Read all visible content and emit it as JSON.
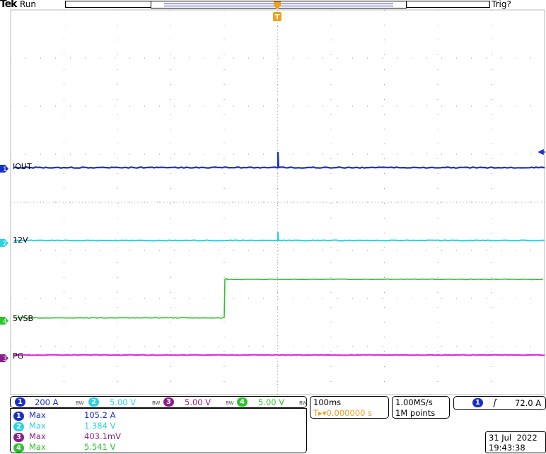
{
  "header": {
    "brand": "Tek",
    "run_state": "Run",
    "trigger_status": "Trig?"
  },
  "colors": {
    "ch1": "#1a2fc8",
    "ch2": "#2ad3e0",
    "ch3": "#8a1f8a",
    "ch4": "#2bc42b",
    "pg_trace": "#e020e0",
    "trigger": "#f0a020",
    "grid": "#9a9a9a"
  },
  "channels": [
    {
      "num": "1",
      "label": "IOUT",
      "scale": "200 A"
    },
    {
      "num": "2",
      "label": "12V",
      "scale": "5.00 V"
    },
    {
      "num": "3",
      "label": "PG",
      "scale": "5.00 V"
    },
    {
      "num": "4",
      "label": "5VSB",
      "scale": "5.00 V"
    }
  ],
  "measurements": [
    {
      "num": "1",
      "name": "Max",
      "value": "105.2 A"
    },
    {
      "num": "2",
      "name": "Max",
      "value": "1.384 V"
    },
    {
      "num": "3",
      "name": "Max",
      "value": "403.1mV"
    },
    {
      "num": "4",
      "name": "Max",
      "value": "5.541 V"
    }
  ],
  "timebase": {
    "scale": "100ms",
    "trigger_pos": "0.000000 s"
  },
  "acquisition": {
    "rate": "1.00MS/s",
    "points": "1M points"
  },
  "trigger": {
    "source": "1",
    "level": "72.0 A",
    "trigger_marker": "T"
  },
  "bandwidth_mark": "BW",
  "datetime": {
    "date": "31 Jul  2022",
    "time": "19:43:38"
  }
}
